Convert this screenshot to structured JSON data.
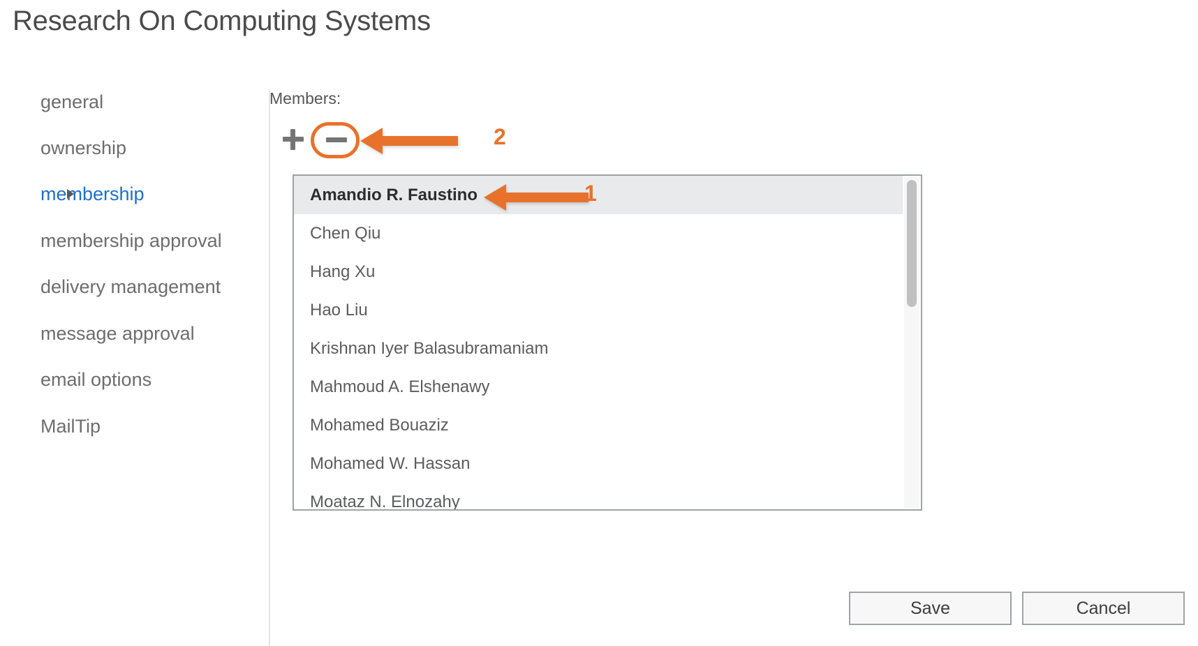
{
  "page": {
    "title": "Research On Computing Systems"
  },
  "sidebar": {
    "items": [
      {
        "label": "general",
        "selected": false
      },
      {
        "label": "ownership",
        "selected": false
      },
      {
        "label": "membership",
        "selected": true
      },
      {
        "label": "membership approval",
        "selected": false
      },
      {
        "label": "delivery management",
        "selected": false
      },
      {
        "label": "message approval",
        "selected": false
      },
      {
        "label": "email options",
        "selected": false
      },
      {
        "label": "MailTip",
        "selected": false
      }
    ]
  },
  "main": {
    "members_label": "Members:",
    "toolbar": {
      "add_icon": "plus-icon",
      "remove_icon": "minus-icon"
    },
    "members": [
      {
        "name": "Amandio R. Faustino",
        "selected": true
      },
      {
        "name": "Chen Qiu",
        "selected": false
      },
      {
        "name": "Hang Xu",
        "selected": false
      },
      {
        "name": "Hao Liu",
        "selected": false
      },
      {
        "name": "Krishnan Iyer Balasubramaniam",
        "selected": false
      },
      {
        "name": "Mahmoud A. Elshenawy",
        "selected": false
      },
      {
        "name": "Mohamed Bouaziz",
        "selected": false
      },
      {
        "name": "Mohamed W. Hassan",
        "selected": false
      },
      {
        "name": "Moataz N. Elnozahy",
        "selected": false
      }
    ]
  },
  "annotations": {
    "callout_one": "1",
    "callout_two": "2",
    "accent_color": "#e8722c"
  },
  "footer": {
    "save_label": "Save",
    "cancel_label": "Cancel"
  }
}
